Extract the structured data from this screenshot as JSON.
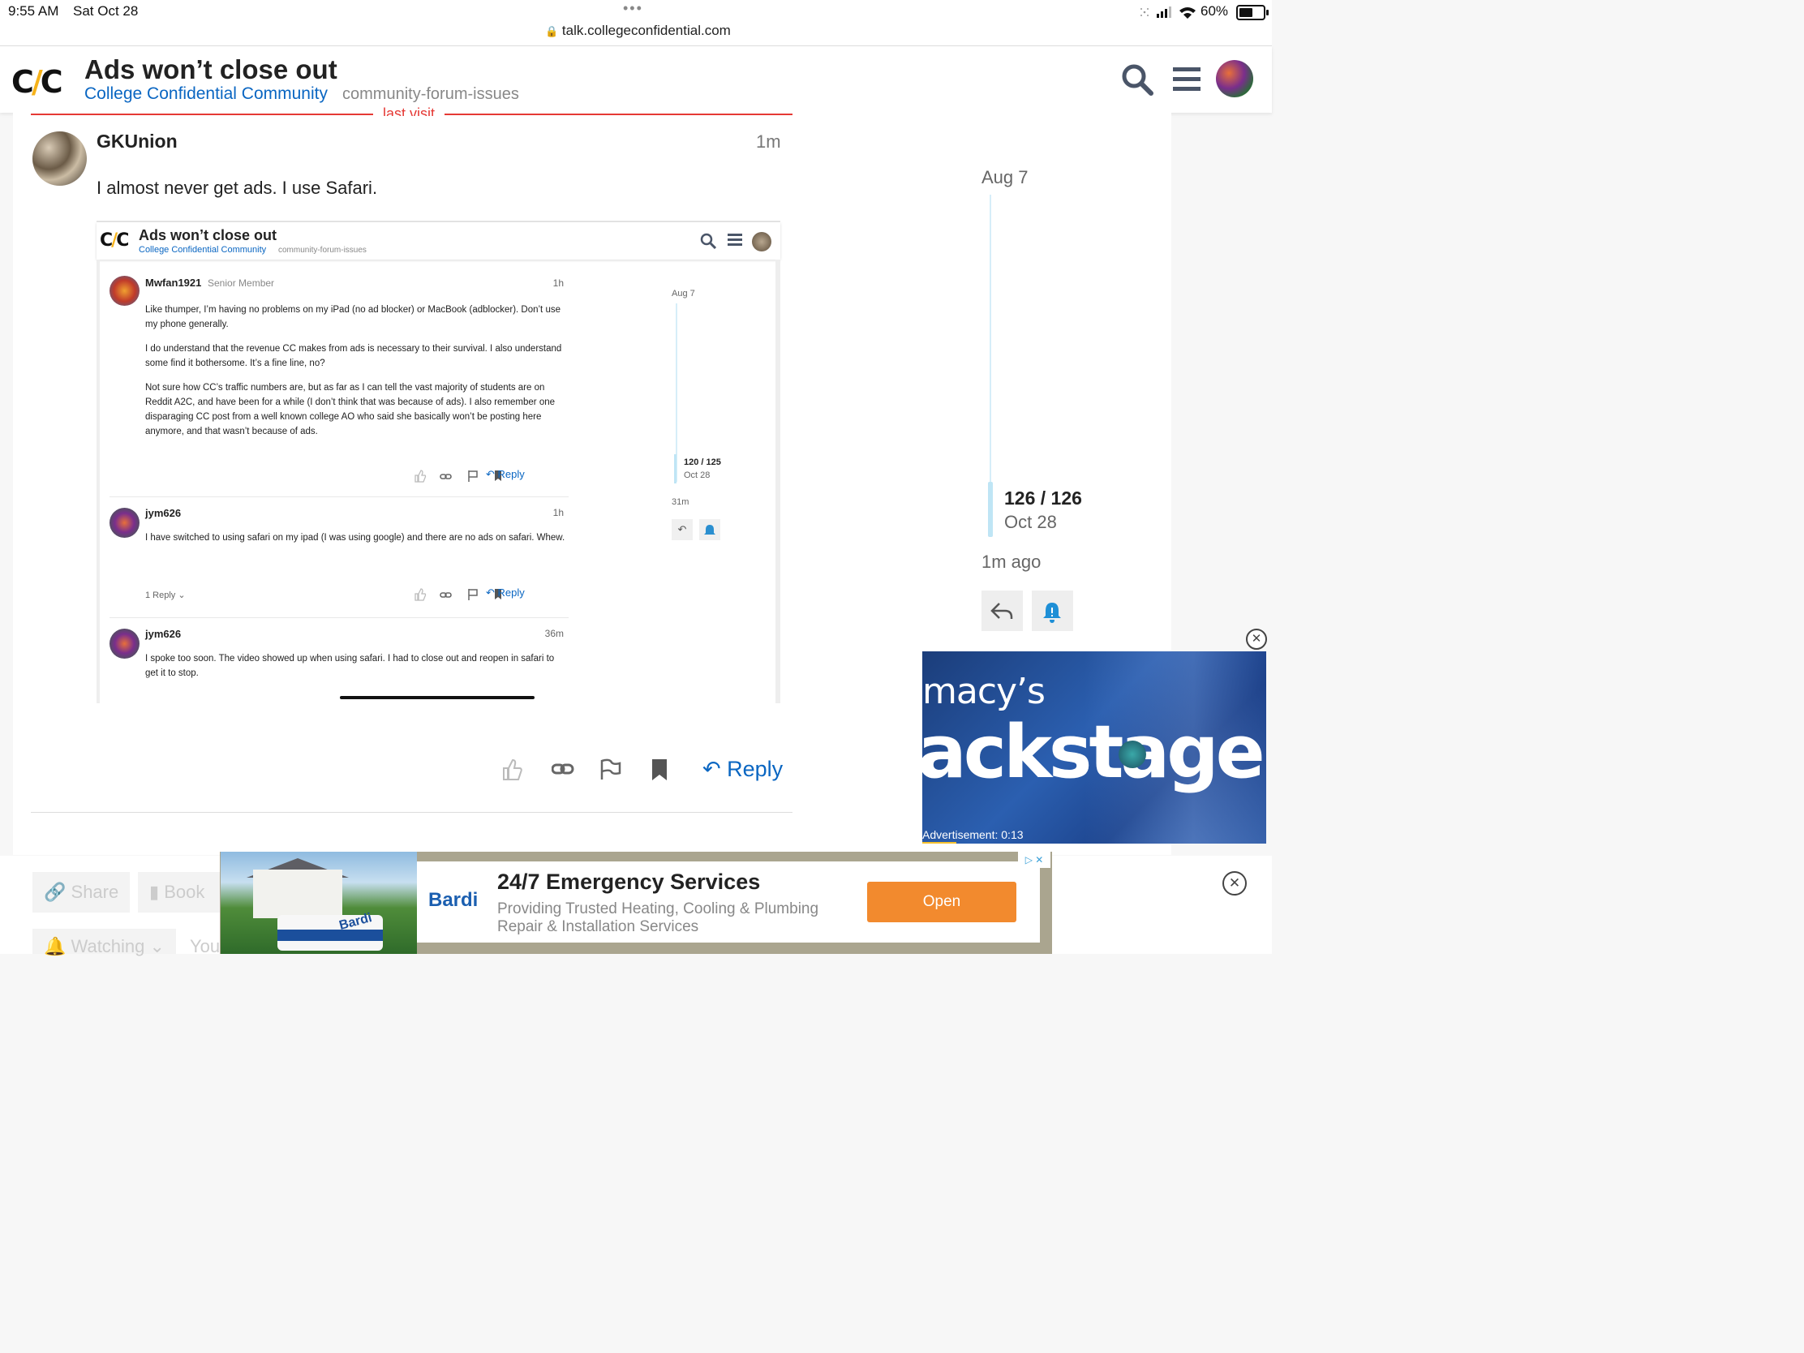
{
  "status_bar": {
    "time": "9:55 AM",
    "date": "Sat Oct 28",
    "dots": "•••",
    "url": "talk.collegeconfidential.com",
    "battery": "60%"
  },
  "header": {
    "logo_left": "C",
    "logo_slash": "/",
    "logo_right": "C",
    "title": "Ads won’t close out",
    "category": "College Confidential Community",
    "tag": "community-forum-issues"
  },
  "post": {
    "last_visit_label": "last visit",
    "username": "GKUnion",
    "time": "1m",
    "text": "I almost never get ads. I use Safari.",
    "reply_label": "Reply"
  },
  "embedded": {
    "title": "Ads won’t close out",
    "category": "College Confidential Community",
    "tag": "community-forum-issues",
    "posts": [
      {
        "username": "Mwfan1921",
        "rank": "Senior Member",
        "time": "1h",
        "paragraphs": [
          "Like thumper, I’m having no problems on my iPad (no ad blocker) or MacBook (adblocker). Don’t use my phone generally.",
          "I do understand that the revenue CC makes from ads is necessary to their survival. I also understand some find it bothersome. It’s a fine line, no?",
          "Not sure how CC’s traffic numbers are, but as far as I can tell the vast majority of students are on Reddit A2C, and have been for a while (I don’t think that was because of ads). I also remember one disparaging CC post from a well known college AO who said she basically won’t be posting here anymore, and that wasn’t because of ads."
        ],
        "reply_label": "Reply"
      },
      {
        "username": "jym626",
        "time": "1h",
        "paragraphs": [
          "I have switched to using safari on my ipad (I was using google) and there are no ads on safari. Whew."
        ],
        "replies_label": "1 Reply",
        "reply_label": "Reply"
      },
      {
        "username": "jym626",
        "time": "36m",
        "paragraphs": [
          "I spoke too soon. The video showed up when using safari. I had to close out and reopen in safari to get it to stop."
        ]
      }
    ],
    "timeline": {
      "start": "Aug 7",
      "count": "120 / 125",
      "date": "Oct 28",
      "ago": "31m"
    }
  },
  "timeline": {
    "start": "Aug 7",
    "count": "126 / 126",
    "date": "Oct 28",
    "ago": "1m ago"
  },
  "footer": {
    "share": "Share",
    "bookmark": "Book",
    "watching": "Watching",
    "you": "You"
  },
  "video_ad": {
    "brand_top": "macy’s",
    "brand_main": "ackstage",
    "ad_label": "Advertisement: 0:13",
    "progress": 0.1
  },
  "banner_ad": {
    "logo": "Bardi",
    "van_logo": "Bardi",
    "headline": "24/7 Emergency Services",
    "line1": "Providing Trusted Heating, Cooling & Plumbing",
    "line2": "Repair & Installation Services",
    "button": "Open",
    "adchoices": "▷ ✕"
  },
  "colors": {
    "accent": "#0a66c2",
    "last_visit": "#e53935",
    "open_button": "#f28a2e",
    "logo_slash": "#f6b21a"
  }
}
